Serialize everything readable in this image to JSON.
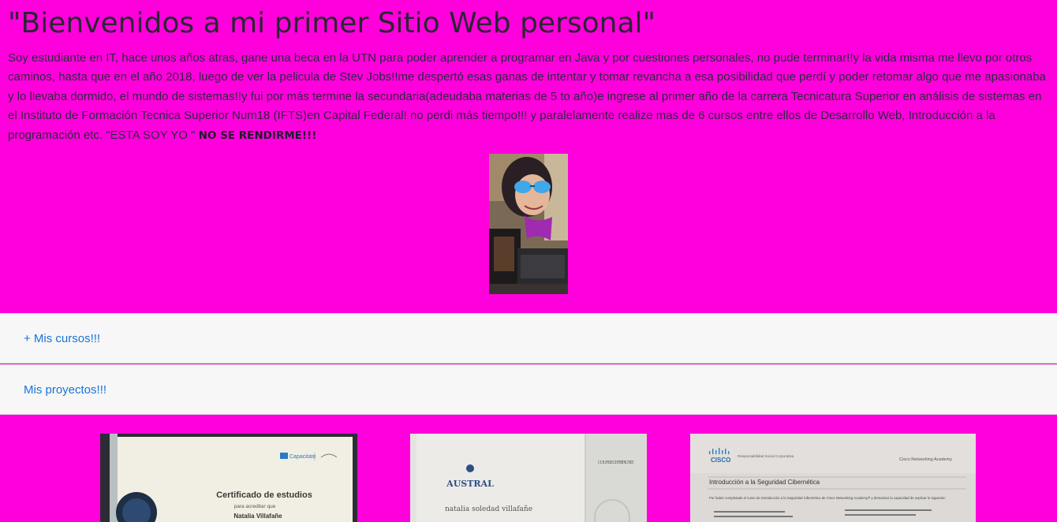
{
  "hero": {
    "title": "\"Bienvenidos a mi primer Sitio Web personal\"",
    "bio": "Soy estudiante en IT, hace unos años atras, gane una beca en la UTN para poder aprender a programar en Java y por cuestiones personales, no pude terminar!!y la vida misma me llevo por otros caminos, hasta que en el año 2018, luego de ver la pelicula de Stev Jobs!!me despertó esas ganas de intentar y tomar revancha a esa posibilidad que perdí y poder retomar algo que me apasionaba y lo llevaba dormido, el mundo de sistemas!!y fui por más termine la secundaria(adeudaba materias de 5 to año)e ingrese al primer año de la carrera Tecnicatura Superior en análisis de sistemas en el Instituto de Formación Tecnica Superior Num18 (IFTS)en Capital Federal! no perdi más tiempo!!! y paralelamente realize mas de 6 cursos entre ellos de Desarrollo Web, Introducción a la programación etc. \"ESTA SOY YO \" ",
    "bio_emphasis": "NO SE RENDIRME!!!"
  },
  "accordion": {
    "courses_label": "+ Mis cursos!!!",
    "projects_label": "Mis proyectos!!!"
  },
  "certificates": [
    {
      "brand": "Capacitate",
      "title": "Certificado de estudios",
      "subtitle": "para acreditar que",
      "name": "Natalia Villafañe"
    },
    {
      "brand": "AUSTRAL",
      "corner": "COURSE CERTIFICATE",
      "name": "natalia soledad villafañe"
    },
    {
      "brand": "CISCO",
      "brand_sub": "Responsabilidad Social Corporativa",
      "academy": "Cisco Networking Academy",
      "heading": "Introducción a la Seguridad Cibernética",
      "body": "Por haber completado el curso de Introducción a la Seguridad Cibernética de Cisco Networking Academy® y demostrar la capacidad de explicar lo siguiente:"
    }
  ],
  "colors": {
    "page_background": "#ff00dd",
    "accordion_background": "#f7f7f7",
    "link": "#1a73d9"
  }
}
